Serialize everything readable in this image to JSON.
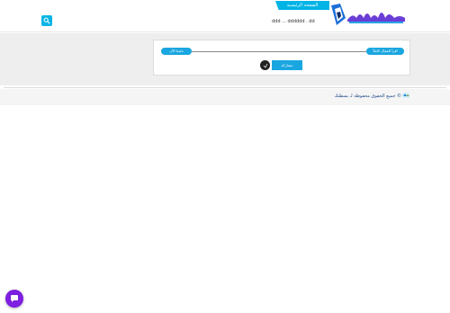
{
  "header": {
    "nav_home_label": "الصفحة الرئيسية",
    "mini_text": "ddd ... dddddd . dd"
  },
  "card": {
    "right_pill": "اقرأ المقال كاملاً",
    "left_pill": "تابعنا الآن",
    "share_label": "مشاركة"
  },
  "footer": {
    "text": "جميع الحقوق محفوظة لـ بسطتك ©"
  },
  "colors": {
    "accent": "#1aa6e0",
    "fab": "#7d1ee0"
  },
  "icons": {
    "search": "search-icon",
    "share": "share-icon",
    "chat": "chat-icon"
  }
}
